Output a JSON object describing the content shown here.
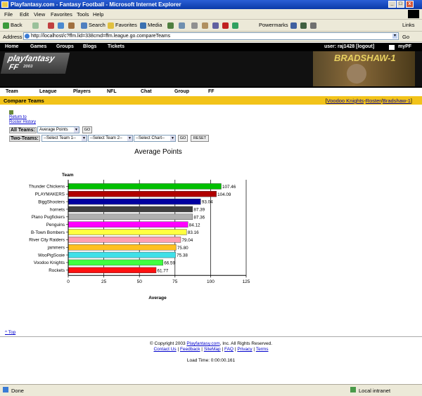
{
  "window": {
    "title": "Playfantasy.com - Fantasy Football - Microsoft Internet Explorer"
  },
  "menu": [
    "File",
    "Edit",
    "View",
    "Favorites",
    "Tools",
    "Help"
  ],
  "toolbar": {
    "back": "Back",
    "search": "Search",
    "favorites": "Favorites",
    "media": "Media",
    "powermarks": "Powermarks",
    "links": "Links"
  },
  "address": {
    "label": "Address",
    "url": "http://localhost/c?ffm.lid=338cmd=ffm.league.go.compareTeams",
    "go": "Go"
  },
  "site": {
    "topnav": [
      "Home",
      "Games",
      "Groups",
      "Blogs",
      "Tickets"
    ],
    "user": "user: raj1428 [logout]",
    "mypf": "myPF",
    "logo1": "playfantasy",
    "logo2": "FF",
    "logo3": "2003",
    "banner_player": "BRADSHAW-1",
    "subnav": [
      "Team",
      "League",
      "Players",
      "NFL",
      "Chat",
      "Group",
      "FF"
    ]
  },
  "page": {
    "title": "Compare Teams",
    "bc_team": "Voodoo Knights",
    "bc_sep1": "-",
    "bc_roster": "Roster",
    "bc_sep2": "/",
    "bc_player": "Bradshaw-1",
    "bc_open": "[",
    "bc_close": "]",
    "return_link": "Return to\nRoster History",
    "all_teams_label": "All Teams:",
    "all_teams_value": "Average Points",
    "go": "GO",
    "two_teams_label": "Two-Teams:",
    "team1_placeholder": "--Select Team 1--",
    "team2_placeholder": "--Select Team 2--",
    "chart_placeholder": "--Select Chart--",
    "reset": "RESET",
    "top_link": "Top"
  },
  "chart_data": {
    "type": "bar",
    "orientation": "horizontal",
    "title": "Average Points",
    "ylabel": "Team",
    "xlabel": "Average",
    "xlim": [
      0,
      125
    ],
    "xticks": [
      0,
      25,
      50,
      75,
      100,
      125
    ],
    "grid": true,
    "categories": [
      "Thunder Chickens",
      "PLAYMAKERS",
      "BiggShooters",
      "hornets",
      "Plano Pugfickers",
      "Penguins",
      "B-Town Bombers",
      "River City Raiders",
      "jammers",
      "WooPigSooie",
      "Voodoo Knights",
      "Rockets"
    ],
    "values": [
      107.46,
      104.09,
      93.04,
      87.39,
      87.36,
      84.12,
      83.16,
      79.04,
      75.8,
      75.38,
      66.59,
      61.77
    ],
    "value_labels": [
      "107.46",
      "104.09",
      "93.04",
      "87.39",
      "87.36",
      "84.12",
      "83.16",
      "79.04",
      "75.80",
      "75.38",
      "66.59",
      "61.77"
    ],
    "colors": [
      "#00c000",
      "#b00000",
      "#0000a0",
      "#404040",
      "#b0b0b0",
      "#ff00ff",
      "#ffff40",
      "#ff9fb0",
      "#ffc020",
      "#40e0e8",
      "#40ff40",
      "#ff1010"
    ]
  },
  "footer": {
    "copyright_pre": "© Copyright 2003",
    "copyright_link": "Playfantasy.com",
    "copyright_post": ", Inc. All Rights Reserved.",
    "links": [
      "Contact Us",
      "Feedback",
      "SiteMap",
      "FAQ",
      "Privacy",
      "Terms"
    ],
    "load_time": "Load Time: 0:00:00.161"
  },
  "status": {
    "left": "Done",
    "right": "Local intranet"
  }
}
